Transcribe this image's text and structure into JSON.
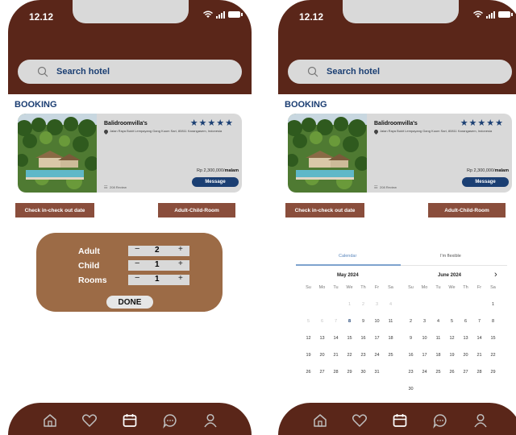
{
  "status": {
    "time": "12.12"
  },
  "search": {
    "label": "Search hotel"
  },
  "booking": {
    "section_title": "BOOKING",
    "hotel_name": "Balidroomvilla's",
    "stars": "★★★★★",
    "address": "Jalan Raya Bukit Lempayang Gang Kuum Sari, 80811 Karangasem, Indonesia",
    "price_value": "Rp 2,300,000/",
    "price_unit": "malam",
    "reviews": "208 Review",
    "message_label": "Message"
  },
  "tabs": {
    "dates_label": "Check in-check out date",
    "guests_label": "Adult-Child-Room"
  },
  "guests": {
    "rows": [
      {
        "label": "Adult",
        "value": "2"
      },
      {
        "label": "Child",
        "value": "1"
      },
      {
        "label": "Rooms",
        "value": "1"
      }
    ],
    "minus": "−",
    "plus": "+",
    "done_label": "DONE"
  },
  "calendar": {
    "tab_calendar": "Calendar",
    "tab_flexible": "I'm flexible",
    "next_glyph": "›",
    "weekdays": [
      "Su",
      "Mo",
      "Tu",
      "We",
      "Th",
      "Fr",
      "Sa"
    ],
    "months": [
      {
        "name": "May 2024",
        "lead": 3,
        "days": 31,
        "past_until": 7,
        "today": 8
      },
      {
        "name": "June 2024",
        "lead": 6,
        "days": 30,
        "past_until": 0,
        "today": 0
      }
    ]
  },
  "nav": {
    "icons": [
      "home-icon",
      "heart-icon",
      "calendar-icon",
      "chat-icon",
      "profile-icon"
    ],
    "active": "calendar-icon"
  },
  "colors": {
    "header": "#5a2619",
    "brand_blue": "#1b3f73",
    "tab_brown": "#8a4e3c",
    "panel": "#9c6b46"
  }
}
